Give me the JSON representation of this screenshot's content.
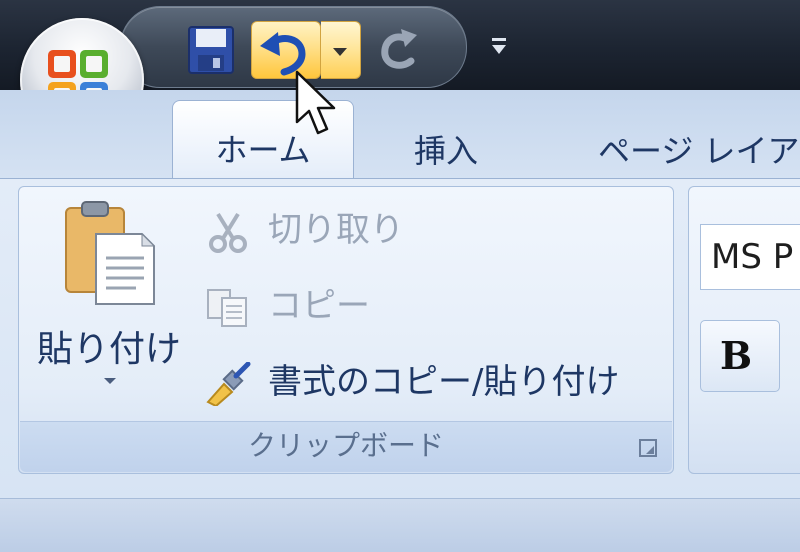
{
  "tabs": [
    {
      "label": "ホーム",
      "selected": true
    },
    {
      "label": "挿入",
      "selected": false
    },
    {
      "label": "ページ レイア",
      "selected": false
    }
  ],
  "quick_access": {
    "icons": [
      "save-icon",
      "undo-icon",
      "dropdown-arrow-icon",
      "redo-icon",
      "customize-icon"
    ]
  },
  "clipboard_group": {
    "label": "クリップボード",
    "paste_label": "貼り付け",
    "cut_label": "切り取り",
    "copy_label": "コピー",
    "format_painter_label": "書式のコピー/貼り付け"
  },
  "font_group": {
    "font_name": "MS P",
    "bold_label": "B"
  },
  "colors": {
    "accent": "#1e3764",
    "disabled": "#9aa6b8",
    "highlight": "#ffd766"
  }
}
